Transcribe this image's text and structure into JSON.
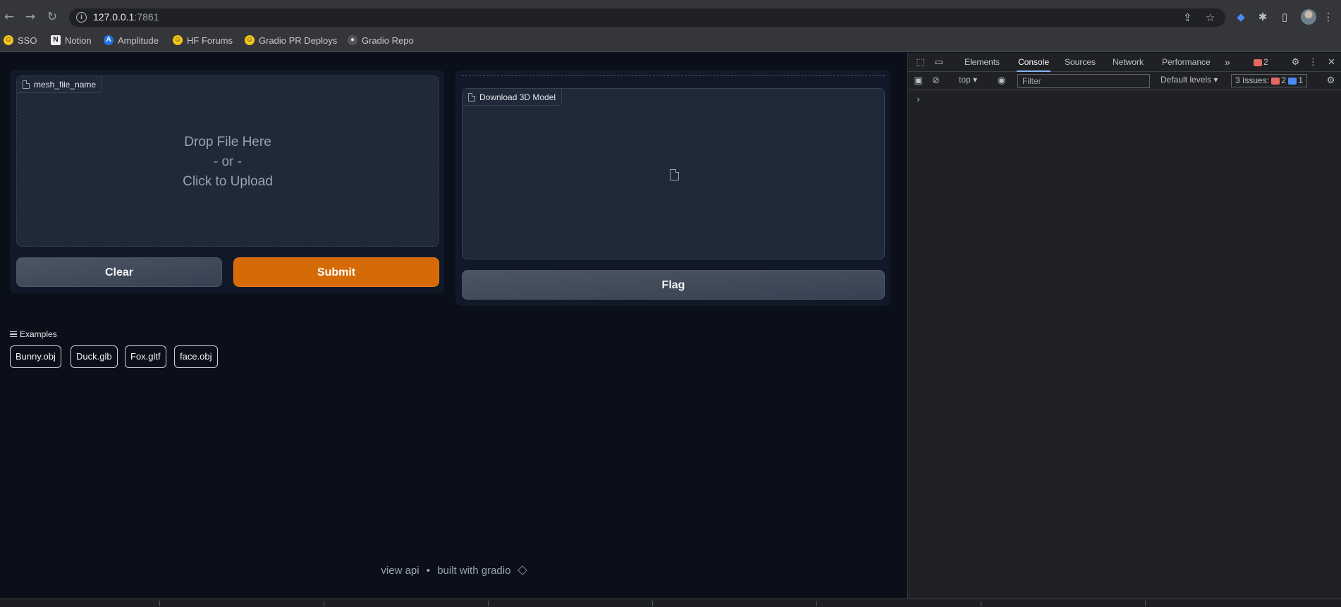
{
  "browser": {
    "url_host": "127.0.0.1",
    "url_port": ":7861",
    "bookmarks": [
      {
        "label": "SSO",
        "icon": "hugging-face-icon"
      },
      {
        "label": "Notion",
        "icon": "notion-icon"
      },
      {
        "label": "Amplitude",
        "icon": "amplitude-icon"
      },
      {
        "label": "HF Forums",
        "icon": "hugging-face-icon"
      },
      {
        "label": "Gradio PR Deploys",
        "icon": "hugging-face-icon"
      },
      {
        "label": "Gradio Repo",
        "icon": "github-icon"
      }
    ]
  },
  "app": {
    "input": {
      "label": "mesh_file_name",
      "drop_line1": "Drop File Here",
      "drop_line2": "- or -",
      "drop_line3": "Click to Upload"
    },
    "output": {
      "label": "Download 3D Model"
    },
    "buttons": {
      "clear": "Clear",
      "submit": "Submit",
      "flag": "Flag"
    },
    "examples": {
      "label": "Examples",
      "items": [
        "Bunny.obj",
        "Duck.glb",
        "Fox.gltf",
        "face.obj"
      ]
    },
    "footer": {
      "view_api": "view api",
      "separator": "•",
      "built_with": "built with gradio"
    },
    "colors": {
      "background": "#0b0f19",
      "panel": "#111827",
      "primary": "#d56b06"
    }
  },
  "devtools": {
    "tabs": [
      "Elements",
      "Console",
      "Sources",
      "Network",
      "Performance"
    ],
    "active_tab": "Console",
    "more": "»",
    "error_count": "2",
    "context": "top",
    "filter_placeholder": "Filter",
    "levels": "Default levels",
    "issues_label": "3 Issues:",
    "issues_errors": "2",
    "issues_info": "1",
    "prompt": "›"
  }
}
